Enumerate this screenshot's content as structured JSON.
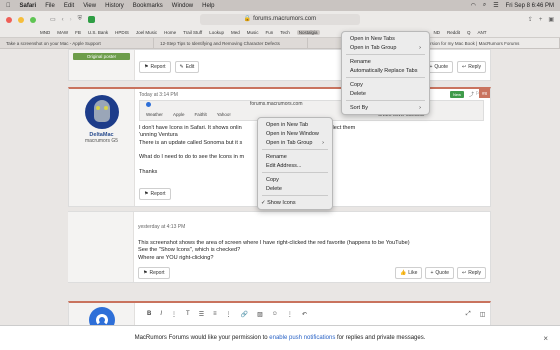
{
  "menubar": {
    "apple": "",
    "app": "Safari",
    "items": [
      "File",
      "Edit",
      "View",
      "History",
      "Bookmarks",
      "Window",
      "Help"
    ],
    "datetime": "Fri Sep 8  6:46 PM"
  },
  "toolbar": {
    "url": "forums.macrumors.com"
  },
  "favorites": [
    "MND",
    "MAW",
    "FB",
    "U.S. Bank",
    "HPDIS",
    "Joel Music",
    "Home",
    "Trail Stuff",
    "Lookup",
    "Med",
    "Music",
    "Fun",
    "Tech",
    "Nostalgia",
    "APS",
    "AT&T",
    "TV",
    "ND",
    "Reddit",
    "Q",
    "ANT"
  ],
  "tabs": [
    "Take a screenshot on your Mac - Apple Support",
    "12-Step Tips to Identifying and Removing Character Defects",
    "",
    "Latest version for my Mac Book | MacRumors Forums"
  ],
  "topmenu": {
    "items": [
      "Open in New Tabs",
      "Open in Tab Group",
      "Rename",
      "Automatically Replace Tabs",
      "Copy",
      "Delete",
      "Sort By"
    ]
  },
  "post1": {
    "role": "Original poster",
    "report": "Report",
    "edit": "Edit",
    "quote": "Quote",
    "reply": "Reply"
  },
  "post2": {
    "author": "DeltaMac",
    "title": "macrumors G5",
    "date": "Today at 3:14 PM",
    "url": "forums.macrumors.com",
    "new": "New",
    "num": "#8",
    "favs": [
      "Weather",
      "Apple",
      "Faithlt",
      "Yahoo!",
      "CNMC clover facebook"
    ],
    "line1": "I don't have Icons in Safari. It shows onlin",
    "line1b": "n to select them",
    "line2": "'unning Ventura",
    "line3": "There is an update called Sonoma but it s",
    "line3b": "r",
    "line4": "What do I need to do to see the Icons in m",
    "line5": "Thanks",
    "report": "Report"
  },
  "ctxmenu": {
    "items": [
      "Open in New Tab",
      "Open in New Window",
      "Open in Tab Group",
      "Rename",
      "Edit Address...",
      "Copy",
      "Delete",
      "Show Icons"
    ],
    "check": "✓"
  },
  "post3": {
    "date": "yesterday at 4:13 PM",
    "p1": "This screenshot shows the area of screen where I have right-clicked the red favorite (happens to be YouTube)",
    "p2": "See the \"Show Icons\", which is checked?",
    "p3": "Where are YOU right-clicking?",
    "report": "Report",
    "like": "Like",
    "quote": "Quote",
    "reply": "Reply"
  },
  "notice": {
    "text1": "MacRumors Forums would like your permission to ",
    "link": "enable push notifications",
    "text2": " for replies and private messages."
  }
}
